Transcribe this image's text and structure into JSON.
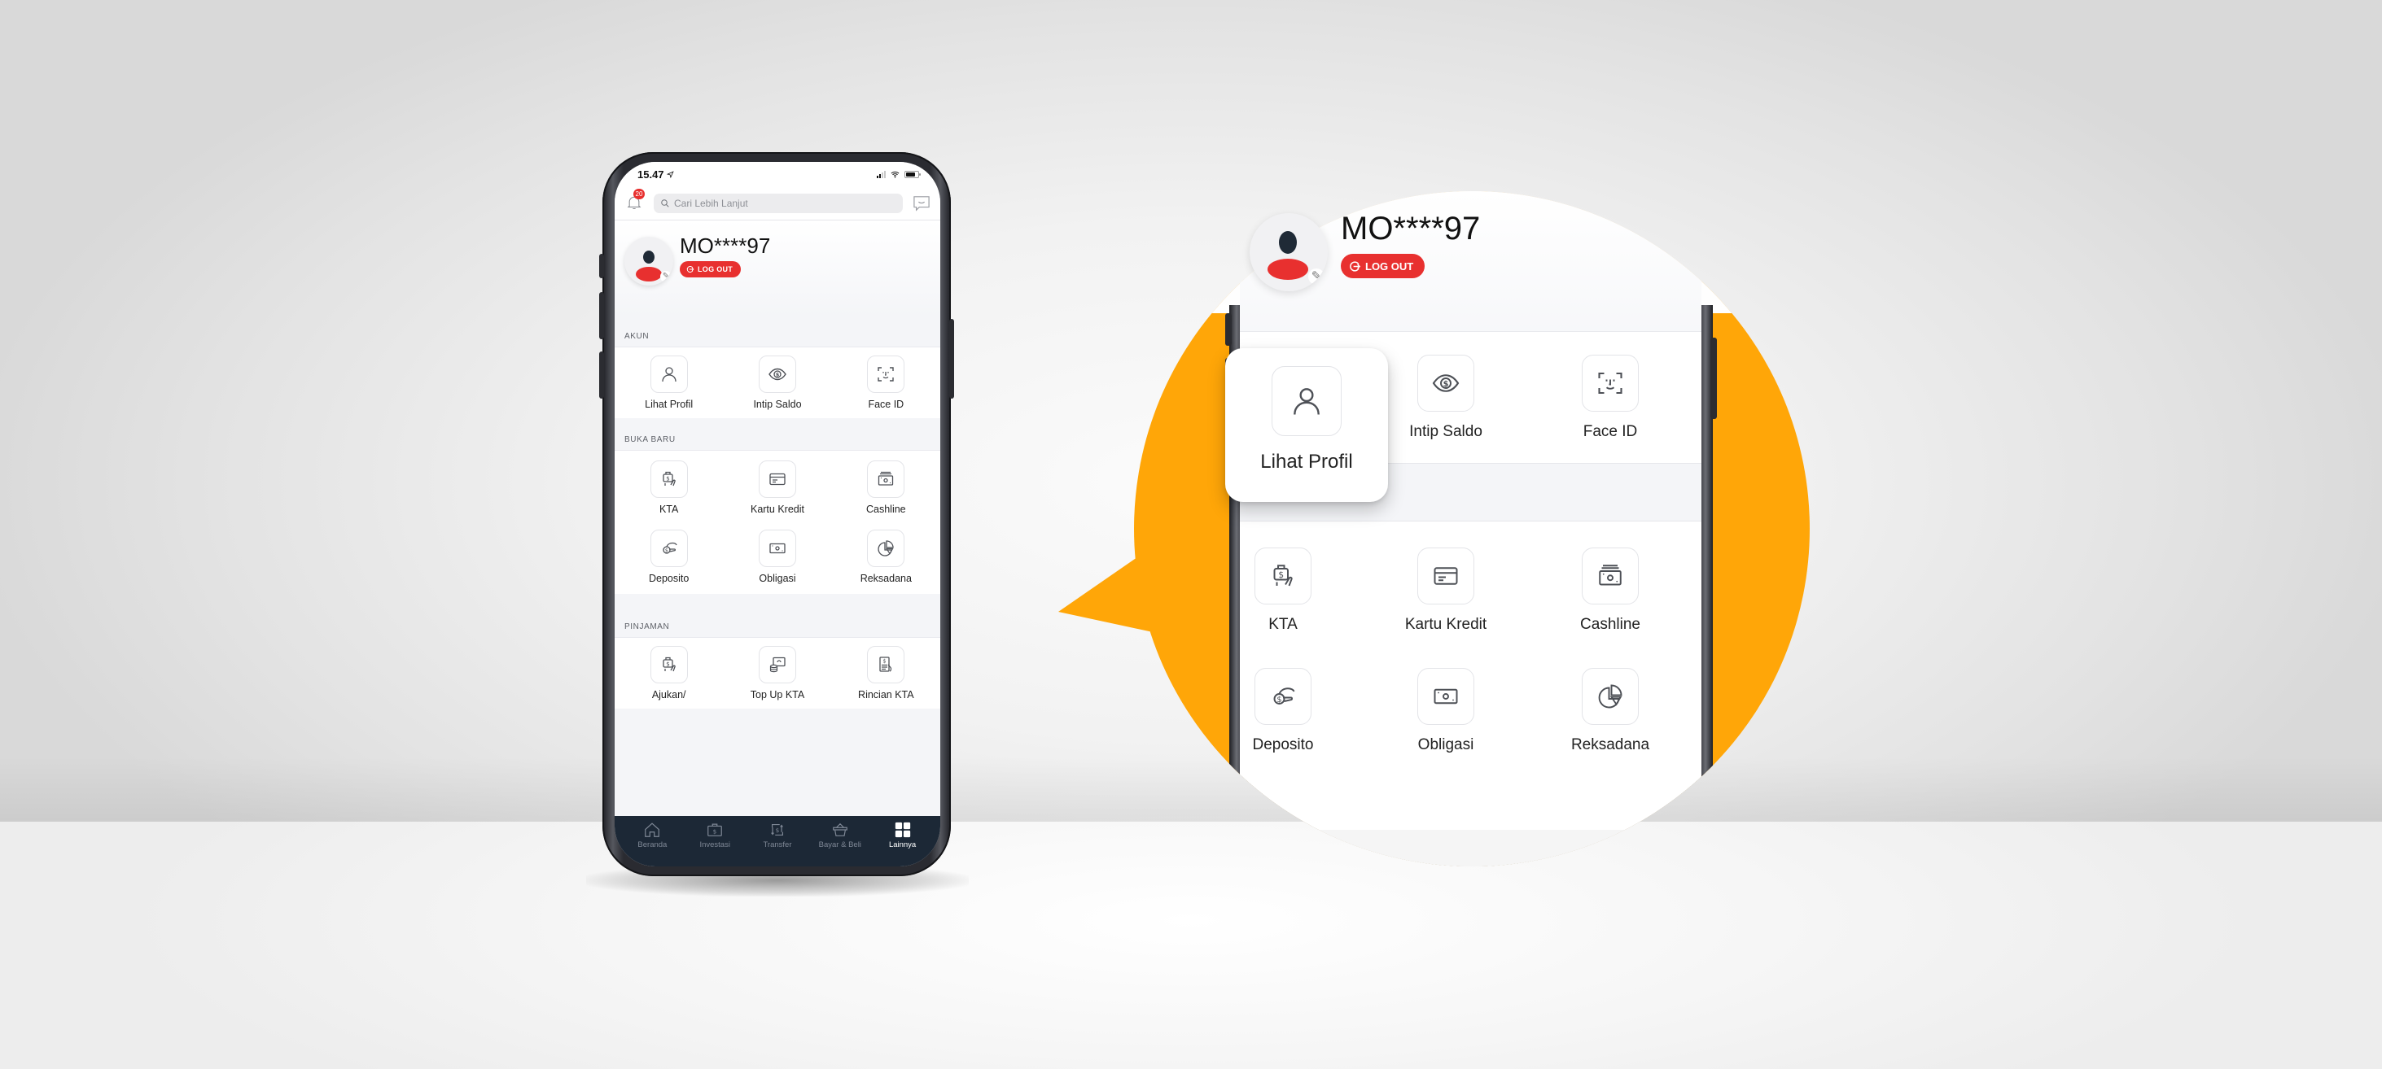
{
  "colors": {
    "accent_orange": "#FFA608",
    "logout_red": "#E8302F",
    "nav_bg": "#1C2836",
    "nav_active": "#FFFFFF",
    "nav_inactive": "#7F8896"
  },
  "status_bar": {
    "time": "15.47",
    "location_icon": "location-arrow-icon",
    "signal_icon": "cellular-signal-icon",
    "wifi_icon": "wifi-icon",
    "battery_icon": "battery-icon"
  },
  "top_bar": {
    "notification_icon": "bell-icon",
    "notification_count": "20",
    "search_placeholder": "Cari Lebih Lanjut",
    "search_icon": "search-icon",
    "message_icon": "message-bubble-icon"
  },
  "profile": {
    "username": "MO****97",
    "logout_label": "LOG OUT",
    "logout_icon": "logout-icon",
    "edit_icon": "pencil-icon"
  },
  "sections": [
    {
      "title": "AKUN",
      "items": [
        {
          "label": "Lihat Profil",
          "icon": "user-icon"
        },
        {
          "label": "Intip Saldo",
          "icon": "eye-dollar-icon"
        },
        {
          "label": "Face ID",
          "icon": "face-id-icon"
        }
      ]
    },
    {
      "title": "BUKA BARU",
      "items": [
        {
          "label": "KTA",
          "icon": "hand-money-icon"
        },
        {
          "label": "Kartu Kredit",
          "icon": "credit-card-icon"
        },
        {
          "label": "Cashline",
          "icon": "cash-stack-icon"
        },
        {
          "label": "Deposito",
          "icon": "hand-coin-icon"
        },
        {
          "label": "Obligasi",
          "icon": "banknote-icon"
        },
        {
          "label": "Reksadana",
          "icon": "pie-chart-icon"
        }
      ]
    },
    {
      "title": "PINJAMAN",
      "items": [
        {
          "label": "Ajukan/",
          "icon": "hand-money-icon"
        },
        {
          "label": "Top Up KTA",
          "icon": "coins-topup-icon"
        },
        {
          "label": "Rincian KTA",
          "icon": "document-dollar-icon"
        }
      ]
    }
  ],
  "bottom_nav": [
    {
      "label": "Beranda",
      "icon": "home-icon",
      "active": false
    },
    {
      "label": "Investasi",
      "icon": "briefcase-dollar-icon",
      "active": false
    },
    {
      "label": "Transfer",
      "icon": "transfer-icon",
      "active": false
    },
    {
      "label": "Bayar & Beli",
      "icon": "basket-icon",
      "active": false
    },
    {
      "label": "Lainnya",
      "icon": "grid-icon",
      "active": true
    }
  ],
  "magnified": {
    "username": "MO****97",
    "logout_label": "LOG OUT",
    "highlight": {
      "label": "Lihat Profil",
      "icon": "user-icon"
    },
    "row1": [
      {
        "label": "Intip Saldo",
        "icon": "eye-dollar-icon"
      },
      {
        "label": "Face ID",
        "icon": "face-id-icon"
      }
    ],
    "section_title": "BUKA BARU",
    "grid": [
      {
        "label": "KTA",
        "icon": "hand-money-icon"
      },
      {
        "label": "Kartu Kredit",
        "icon": "credit-card-icon"
      },
      {
        "label": "Cashline",
        "icon": "cash-stack-icon"
      },
      {
        "label": "Deposito",
        "icon": "hand-coin-icon"
      },
      {
        "label": "Obligasi",
        "icon": "banknote-icon"
      },
      {
        "label": "Reksadana",
        "icon": "pie-chart-icon"
      }
    ]
  }
}
